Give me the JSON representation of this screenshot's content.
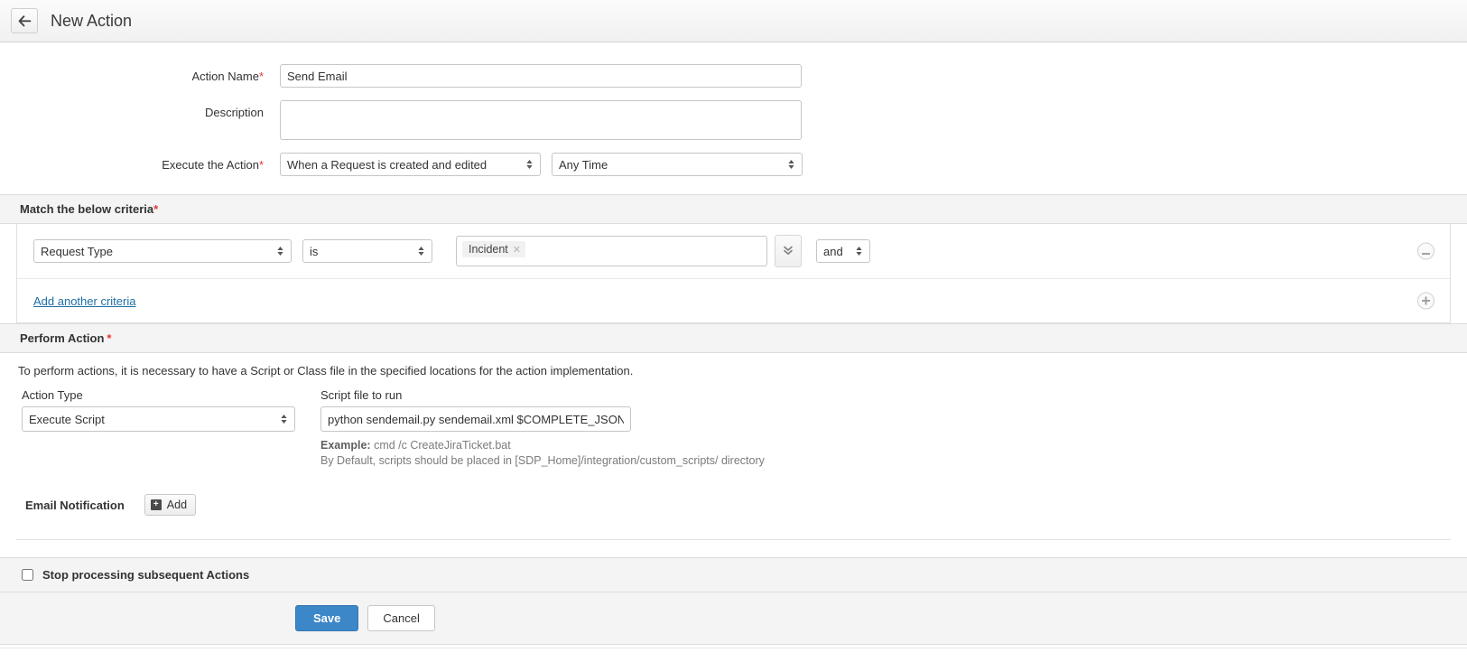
{
  "header": {
    "title": "New Action",
    "back_icon": "arrow-left-icon"
  },
  "form": {
    "action_name": {
      "label": "Action Name",
      "required": "*",
      "value": "Send Email"
    },
    "description": {
      "label": "Description",
      "value": ""
    },
    "execute_the_action": {
      "label": "Execute the Action",
      "required": "*",
      "trigger_value": "When a Request is created and edited",
      "trigger_options": [
        "When a Request is created and edited"
      ],
      "time_value": "Any Time",
      "time_options": [
        "Any Time"
      ]
    }
  },
  "criteria_section": {
    "title": "Match the below criteria",
    "required": "*",
    "rows": [
      {
        "field_value": "Request Type",
        "field_options": [
          "Request Type"
        ],
        "condition_value": "is",
        "condition_options": [
          "is"
        ],
        "chips": [
          {
            "label": "Incident",
            "remove_icon": "close-icon"
          }
        ],
        "expand_icon": "double-chevron-down-icon",
        "logic_value": "and",
        "logic_options": [
          "and"
        ],
        "remove_icon": "minus-circle-icon"
      }
    ],
    "add_link": "Add another criteria",
    "add_icon": "plus-circle-icon"
  },
  "perform_action": {
    "title": "Perform Action",
    "required": "*",
    "description": "To perform actions, it is necessary to have a Script or Class file in the specified locations for the action implementation.",
    "action_type": {
      "label": "Action Type",
      "value": "Execute Script",
      "options": [
        "Execute Script"
      ]
    },
    "script_file": {
      "label": "Script file to run",
      "value": "python sendemail.py sendemail.xml $COMPLETE_JSON_FII"
    },
    "hint_example_label": "Example:",
    "hint_example_text": " cmd /c CreateJiraTicket.bat",
    "hint_default": "By Default, scripts should be placed in [SDP_Home]/integration/custom_scripts/ directory"
  },
  "email_notification": {
    "label": "Email Notification",
    "add_button": "Add",
    "add_icon": "plus-square-icon"
  },
  "stop_processing": {
    "label": "Stop processing subsequent Actions",
    "checked": false
  },
  "footer": {
    "save_label": "Save",
    "cancel_label": "Cancel"
  },
  "colors": {
    "accent": "#3c87c8",
    "required": "#e4383a",
    "link": "#1d6fa5",
    "section_bg": "#f4f4f4"
  }
}
